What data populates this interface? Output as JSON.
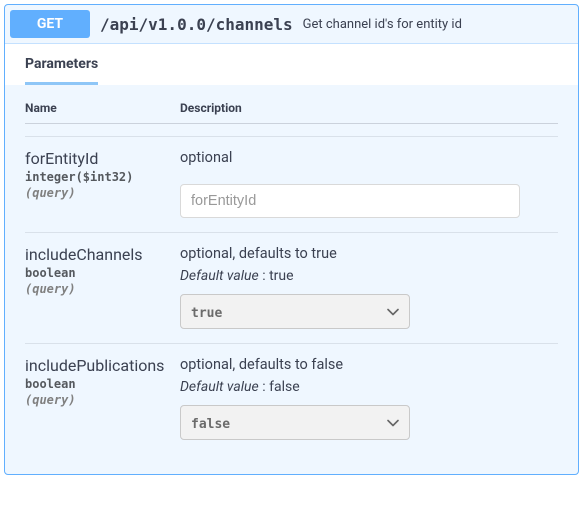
{
  "op": {
    "method": "GET",
    "path": "/api/v1.0.0/channels",
    "summary": "Get channel id's for entity id"
  },
  "section": {
    "tab_label": "Parameters",
    "col_name": "Name",
    "col_desc": "Description"
  },
  "params": [
    {
      "name": "forEntityId",
      "type": "integer($int32)",
      "in": "(query)",
      "desc": "optional",
      "default_label": "",
      "default_value": "",
      "control": "text",
      "placeholder": "forEntityId",
      "value": ""
    },
    {
      "name": "includeChannels",
      "type": "boolean",
      "in": "(query)",
      "desc": "optional, defaults to true",
      "default_label": "Default value",
      "default_value": "true",
      "control": "select",
      "selected": "true"
    },
    {
      "name": "includePublications",
      "type": "boolean",
      "in": "(query)",
      "desc": "optional, defaults to false",
      "default_label": "Default value",
      "default_value": "false",
      "control": "select",
      "selected": "false"
    }
  ]
}
